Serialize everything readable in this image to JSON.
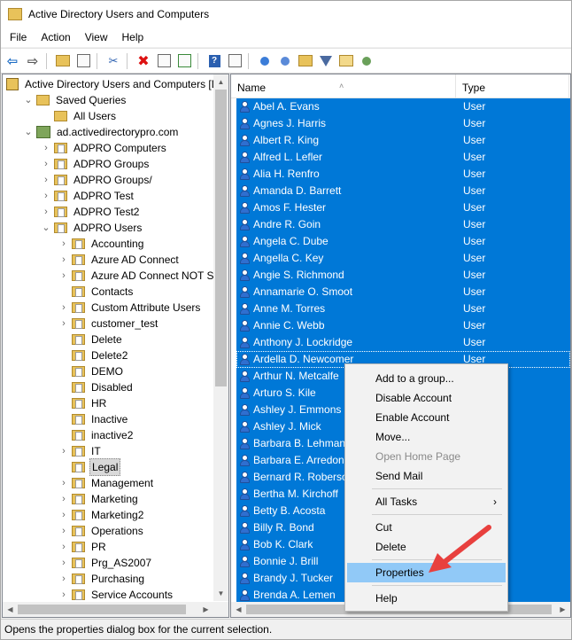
{
  "window": {
    "title": "Active Directory Users and Computers"
  },
  "menu": [
    "File",
    "Action",
    "View",
    "Help"
  ],
  "toolbar_icons": [
    "back-arrow-icon",
    "forward-arrow-icon",
    "up-folder-icon",
    "show-console-tree-icon",
    "cut-icon",
    "delete-icon",
    "properties-icon",
    "export-list-icon",
    "help-icon",
    "console-icon",
    "new-user-icon",
    "new-group-icon",
    "new-ou-icon",
    "filter-icon",
    "find-icon",
    "add-to-group-icon"
  ],
  "tree": {
    "root": "Active Directory Users and Computers [D",
    "items": [
      {
        "label": "Saved Queries",
        "depth": 1,
        "chev": "v",
        "icon": "folder"
      },
      {
        "label": "All Users",
        "depth": 2,
        "chev": "",
        "icon": "folder"
      },
      {
        "label": "ad.activedirectorypro.com",
        "depth": 1,
        "chev": "v",
        "icon": "domain"
      },
      {
        "label": "ADPRO Computers",
        "depth": 2,
        "chev": ">",
        "icon": "folder-doc"
      },
      {
        "label": "ADPRO Groups",
        "depth": 2,
        "chev": ">",
        "icon": "folder-doc"
      },
      {
        "label": "ADPRO Groups/",
        "depth": 2,
        "chev": ">",
        "icon": "folder-doc"
      },
      {
        "label": "ADPRO Test",
        "depth": 2,
        "chev": ">",
        "icon": "folder-doc"
      },
      {
        "label": "ADPRO Test2",
        "depth": 2,
        "chev": ">",
        "icon": "folder-doc"
      },
      {
        "label": "ADPRO Users",
        "depth": 2,
        "chev": "v",
        "icon": "folder-doc"
      },
      {
        "label": "Accounting",
        "depth": 3,
        "chev": ">",
        "icon": "folder-doc"
      },
      {
        "label": "Azure AD Connect",
        "depth": 3,
        "chev": ">",
        "icon": "folder-doc"
      },
      {
        "label": "Azure AD Connect NOT Synce",
        "depth": 3,
        "chev": ">",
        "icon": "folder-doc"
      },
      {
        "label": "Contacts",
        "depth": 3,
        "chev": "",
        "icon": "folder-doc"
      },
      {
        "label": "Custom Attribute Users",
        "depth": 3,
        "chev": ">",
        "icon": "folder-doc"
      },
      {
        "label": "customer_test",
        "depth": 3,
        "chev": ">",
        "icon": "folder-doc"
      },
      {
        "label": "Delete",
        "depth": 3,
        "chev": "",
        "icon": "folder-doc"
      },
      {
        "label": "Delete2",
        "depth": 3,
        "chev": "",
        "icon": "folder-doc"
      },
      {
        "label": "DEMO",
        "depth": 3,
        "chev": "",
        "icon": "folder-doc"
      },
      {
        "label": "Disabled",
        "depth": 3,
        "chev": "",
        "icon": "folder-doc"
      },
      {
        "label": "HR",
        "depth": 3,
        "chev": "",
        "icon": "folder-doc"
      },
      {
        "label": "Inactive",
        "depth": 3,
        "chev": "",
        "icon": "folder-doc"
      },
      {
        "label": "inactive2",
        "depth": 3,
        "chev": "",
        "icon": "folder-doc"
      },
      {
        "label": "IT",
        "depth": 3,
        "chev": ">",
        "icon": "folder-doc"
      },
      {
        "label": "Legal",
        "depth": 3,
        "chev": "",
        "icon": "folder-doc",
        "selected": true
      },
      {
        "label": "Management",
        "depth": 3,
        "chev": ">",
        "icon": "folder-doc"
      },
      {
        "label": "Marketing",
        "depth": 3,
        "chev": ">",
        "icon": "folder-doc"
      },
      {
        "label": "Marketing2",
        "depth": 3,
        "chev": ">",
        "icon": "folder-doc"
      },
      {
        "label": "Operations",
        "depth": 3,
        "chev": ">",
        "icon": "folder-doc"
      },
      {
        "label": "PR",
        "depth": 3,
        "chev": ">",
        "icon": "folder-doc"
      },
      {
        "label": "Prg_AS2007",
        "depth": 3,
        "chev": ">",
        "icon": "folder-doc"
      },
      {
        "label": "Purchasing",
        "depth": 3,
        "chev": ">",
        "icon": "folder-doc"
      },
      {
        "label": "Service Accounts",
        "depth": 3,
        "chev": ">",
        "icon": "folder-doc"
      }
    ]
  },
  "list": {
    "columns": [
      "Name",
      "Type"
    ],
    "rows": [
      {
        "name": "Abel A. Evans",
        "type": "User"
      },
      {
        "name": "Agnes J. Harris",
        "type": "User"
      },
      {
        "name": "Albert R. King",
        "type": "User"
      },
      {
        "name": "Alfred L. Lefler",
        "type": "User"
      },
      {
        "name": "Alia H. Renfro",
        "type": "User"
      },
      {
        "name": "Amanda D. Barrett",
        "type": "User"
      },
      {
        "name": "Amos F. Hester",
        "type": "User"
      },
      {
        "name": "Andre R. Goin",
        "type": "User"
      },
      {
        "name": "Angela C. Dube",
        "type": "User"
      },
      {
        "name": "Angella C. Key",
        "type": "User"
      },
      {
        "name": "Angie S. Richmond",
        "type": "User"
      },
      {
        "name": "Annamarie O. Smoot",
        "type": "User"
      },
      {
        "name": "Anne M. Torres",
        "type": "User"
      },
      {
        "name": "Annie C. Webb",
        "type": "User"
      },
      {
        "name": "Anthony J. Lockridge",
        "type": "User"
      },
      {
        "name": "Ardella D. Newcomer",
        "type": "User"
      },
      {
        "name": "Arthur N. Metcalfe",
        "type": ""
      },
      {
        "name": "Arturo S. Kile",
        "type": ""
      },
      {
        "name": "Ashley J. Emmons",
        "type": ""
      },
      {
        "name": "Ashley J. Mick",
        "type": ""
      },
      {
        "name": "Barbara B. Lehman",
        "type": ""
      },
      {
        "name": "Barbara E. Arredond",
        "type": ""
      },
      {
        "name": "Bernard R. Roberson",
        "type": ""
      },
      {
        "name": "Bertha M. Kirchoff",
        "type": ""
      },
      {
        "name": "Betty B. Acosta",
        "type": ""
      },
      {
        "name": "Billy R. Bond",
        "type": ""
      },
      {
        "name": "Bob K. Clark",
        "type": ""
      },
      {
        "name": "Bonnie J. Brill",
        "type": ""
      },
      {
        "name": "Brandy J. Tucker",
        "type": ""
      },
      {
        "name": "Brenda A. Lemen",
        "type": ""
      }
    ]
  },
  "context_menu": {
    "items": [
      {
        "label": "Add to a group...",
        "state": "normal"
      },
      {
        "label": "Disable Account",
        "state": "normal"
      },
      {
        "label": "Enable Account",
        "state": "normal"
      },
      {
        "label": "Move...",
        "state": "normal"
      },
      {
        "label": "Open Home Page",
        "state": "disabled"
      },
      {
        "label": "Send Mail",
        "state": "normal"
      },
      {
        "sep": true
      },
      {
        "label": "All Tasks",
        "state": "normal",
        "submenu": true
      },
      {
        "sep": true
      },
      {
        "label": "Cut",
        "state": "normal"
      },
      {
        "label": "Delete",
        "state": "normal"
      },
      {
        "sep": true
      },
      {
        "label": "Properties",
        "state": "hover"
      },
      {
        "sep": true
      },
      {
        "label": "Help",
        "state": "normal"
      }
    ]
  },
  "status": {
    "text": "Opens the properties dialog box for the current selection."
  },
  "colors": {
    "selection": "#0078d7",
    "menu_hover": "#91c9f7",
    "arrow": "#e8403e"
  }
}
